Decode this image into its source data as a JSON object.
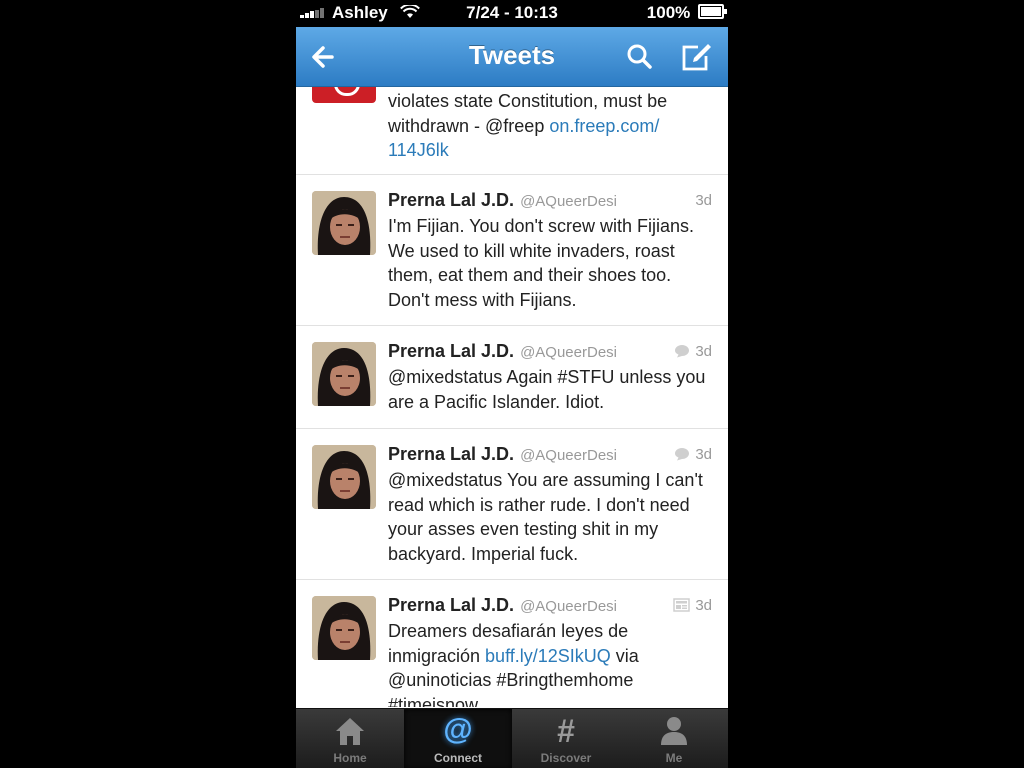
{
  "status_bar": {
    "carrier": "Ashley",
    "time": "7/24 - 10:13",
    "battery": "100%"
  },
  "navbar": {
    "title": "Tweets",
    "back_icon": "arrow-left-icon",
    "search_icon": "search-icon",
    "compose_icon": "compose-icon"
  },
  "partial_tweet": {
    "text_lines": [
      "violates state Constitution, must be",
      "withdrawn - @freep "
    ],
    "link_part1": "on.freep.com/",
    "link_part2": "114J6lk"
  },
  "tweets": [
    {
      "name": "Prerna Lal J.D.",
      "handle": "@AQueerDesi",
      "time": "3d",
      "meta_icon": "",
      "text": "I'm Fijian. You don't screw with Fijians. We used to kill white invaders, roast them, eat them and their shoes too. Don't mess with Fijians."
    },
    {
      "name": "Prerna Lal J.D.",
      "handle": "@AQueerDesi",
      "time": "3d",
      "meta_icon": "conversation-icon",
      "text": "@mixedstatus Again #STFU unless you are a Pacific Islander. Idiot."
    },
    {
      "name": "Prerna Lal J.D.",
      "handle": "@AQueerDesi",
      "time": "3d",
      "meta_icon": "conversation-icon",
      "text": "@mixedstatus You are assuming I can't read which is rather rude. I don't need your asses even testing shit in my backyard. Imperial fuck."
    },
    {
      "name": "Prerna Lal J.D.",
      "handle": "@AQueerDesi",
      "time": "3d",
      "meta_icon": "media-card-icon",
      "text_before": "Dreamers desafiarán leyes de inmigración ",
      "link": "buff.ly/12SIkUQ",
      "text_after": " via @uninoticias #Bringthemhome #timeisnow"
    }
  ],
  "tabbar": {
    "tabs": [
      {
        "label": "Home",
        "icon": "home-icon",
        "active": false
      },
      {
        "label": "Connect",
        "icon": "at-sign-icon",
        "active": true
      },
      {
        "label": "Discover",
        "icon": "hashtag-icon",
        "active": false
      },
      {
        "label": "Me",
        "icon": "person-icon",
        "active": false
      }
    ]
  },
  "colors": {
    "nav_top": "#5ea9e6",
    "nav_bottom": "#2d7cc4",
    "link": "#2b7bb9",
    "active_tab": "#5fb4ff"
  }
}
